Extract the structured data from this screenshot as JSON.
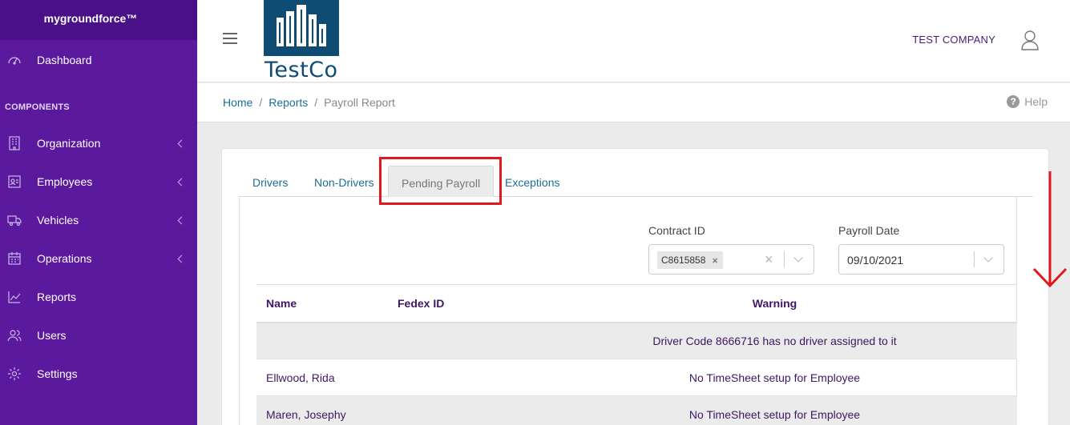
{
  "brand": {
    "name": "mygroundforce™"
  },
  "sidebar": {
    "section_label": "COMPONENTS",
    "items": [
      {
        "label": "Dashboard",
        "icon": "dashboard-icon",
        "has_children": false
      },
      {
        "label": "Organization",
        "icon": "building-icon",
        "has_children": true
      },
      {
        "label": "Employees",
        "icon": "id-card-icon",
        "has_children": true
      },
      {
        "label": "Vehicles",
        "icon": "truck-icon",
        "has_children": true
      },
      {
        "label": "Operations",
        "icon": "calendar-icon",
        "has_children": true
      },
      {
        "label": "Reports",
        "icon": "chart-line-icon",
        "has_children": false
      },
      {
        "label": "Users",
        "icon": "users-icon",
        "has_children": false
      },
      {
        "label": "Settings",
        "icon": "gear-icon",
        "has_children": false
      }
    ]
  },
  "header": {
    "logo_text": "TestCo",
    "company": "TEST COMPANY"
  },
  "breadcrumb": {
    "items": [
      "Home",
      "Reports",
      "Payroll Report"
    ],
    "separator": "/",
    "help_label": "Help"
  },
  "tabs": [
    {
      "label": "Drivers",
      "active": false
    },
    {
      "label": "Non-Drivers",
      "active": false
    },
    {
      "label": "Pending Payroll",
      "active": true
    },
    {
      "label": "Exceptions",
      "active": false
    }
  ],
  "filters": {
    "contract_id": {
      "label": "Contract ID",
      "selected_chip": "C8615858",
      "remove_glyph": "×",
      "clear_glyph": "×"
    },
    "payroll_date": {
      "label": "Payroll Date",
      "value": "09/10/2021"
    }
  },
  "table": {
    "columns": [
      "Name",
      "Fedex ID",
      "Warning"
    ],
    "rows": [
      {
        "name": "",
        "fedex_id": "",
        "warning": "Driver Code 8666716 has no driver assigned to it"
      },
      {
        "name": "Ellwood, Rida",
        "fedex_id": "",
        "warning": "No TimeSheet setup for Employee"
      },
      {
        "name": "Maren, Josephy",
        "fedex_id": "",
        "warning": "No TimeSheet setup for Employee"
      }
    ]
  },
  "colors": {
    "sidebar_bg": "#5b1a9e",
    "brand_bg": "#4a1087",
    "link": "#1a6f96",
    "heading_text": "#3f1764",
    "logo_blue": "#0f4c74",
    "highlight_red": "#e0191f"
  }
}
